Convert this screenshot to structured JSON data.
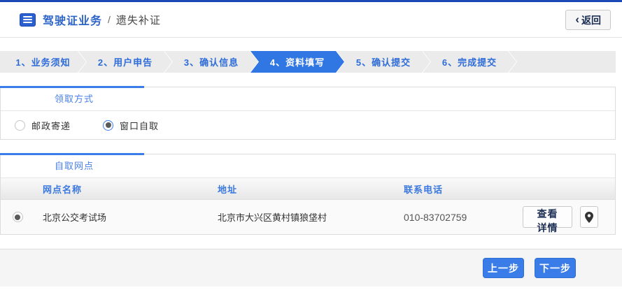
{
  "header": {
    "title": "驾驶证业务",
    "separator": "/",
    "subtitle": "遗失补证",
    "back_chevron": "‹",
    "back_label": "返回"
  },
  "steps": [
    {
      "label": "1、业务须知",
      "active": false
    },
    {
      "label": "2、用户申告",
      "active": false
    },
    {
      "label": "3、确认信息",
      "active": false
    },
    {
      "label": "4、资料填写",
      "active": true
    },
    {
      "label": "5、确认提交",
      "active": false
    },
    {
      "label": "6、完成提交",
      "active": false
    }
  ],
  "pickup_section": {
    "tab_label": "领取方式",
    "options": [
      {
        "label": "邮政寄递",
        "selected": false
      },
      {
        "label": "窗口自取",
        "selected": true
      }
    ]
  },
  "outlet_section": {
    "tab_label": "自取网点",
    "columns": {
      "name": "网点名称",
      "address": "地址",
      "phone": "联系电话"
    },
    "rows": [
      {
        "selected": true,
        "name": "北京公交考试场",
        "address": "北京市大兴区黄村镇狼垡村",
        "phone": "010-83702759",
        "detail_label": "查看详情",
        "pin_icon": "location-pin"
      }
    ]
  },
  "footer": {
    "prev_label": "上一步",
    "next_label": "下一步"
  },
  "icons": {
    "header_icon": "list-card-icon",
    "back_icon": "chevron-left-icon",
    "pin_icon": "location-pin-icon"
  },
  "colors": {
    "topbar": "#1b48b4",
    "accent_blue": "#3b7de8",
    "active_step": "#3077e3",
    "step_text": "#2e6cd9",
    "title_blue": "#2d64c8",
    "button_blue": "#3b7de8",
    "step_bg": "#ebebeb"
  }
}
